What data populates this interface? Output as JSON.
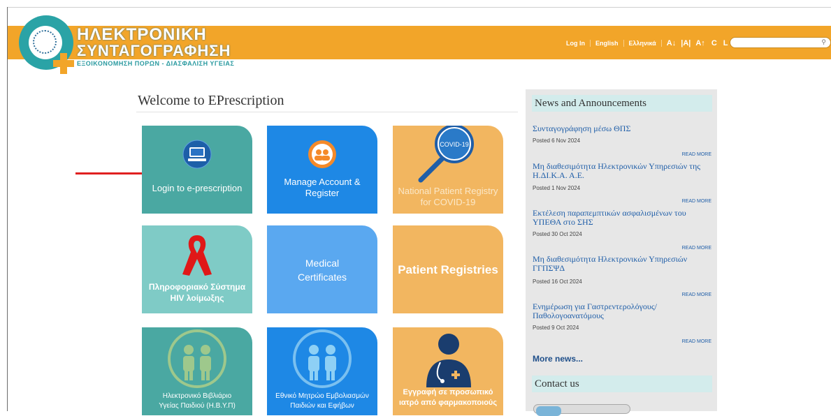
{
  "header": {
    "logo_line1": "ΗΛΕΚΤΡΟΝΙΚΗ",
    "logo_line2": "ΣΥΝΤΑΓΟΓΡΑΦΗΣΗ",
    "logo_tagline": "ΕΞΟΙΚΟΝΟΜΗΣΗ ΠΟΡΩΝ - ΔΙΑΣΦΑΛΙΣΗ ΥΓΕΙΑΣ",
    "nav": {
      "login": "Log In",
      "english": "English",
      "greek": "Ελληνικά",
      "font_decrease": "A↓",
      "font_reset": "|A|",
      "font_increase": "A↑",
      "contrast": "C",
      "layout": "L"
    },
    "search": {
      "placeholder": "",
      "icon": "search-icon"
    }
  },
  "main": {
    "title": "Welcome to EPrescription",
    "tiles": [
      {
        "label": "Login to e-prescription",
        "color": "#4aa8a2",
        "icon": "monitor-icon"
      },
      {
        "label": "Manage Account & Register",
        "color": "#1e88e5",
        "icon": "account-icon"
      },
      {
        "label": "National Patient Registry for COVID-19",
        "color": "#f2b660",
        "icon": "covid-magnifier-icon",
        "badge": "COVID-19"
      },
      {
        "label": "Πληροφοριακό Σύστημα HIV λοίμωξης",
        "color": "#7fcbc6",
        "icon": "red-ribbon-icon"
      },
      {
        "label": "Medical Certificates",
        "color": "#5aa8f0"
      },
      {
        "label": "Patient Registries",
        "color": "#f2b660"
      },
      {
        "label": "Ηλεκτρονικό Βιβλιάριο Υγείας Παιδιού (Η.Β.Υ.Π)",
        "color": "#4aa8a2",
        "icon": "children-icon"
      },
      {
        "label": "Εθνικό Μητρώο Εμβολιασμών Παιδιών και Εφήβων",
        "color": "#1e88e5",
        "icon": "children-icon"
      },
      {
        "label": "Εγγραφή σε προσωπικό ιατρό από φαρμακοποιούς",
        "color": "#f2b660",
        "icon": "doctor-icon"
      }
    ]
  },
  "sidebar": {
    "news_heading": "News and Announcements",
    "news": [
      {
        "title": "Συνταγογράφηση μέσω ΘΠΣ",
        "date": "Posted 6 Nov 2024",
        "more": "READ MORE"
      },
      {
        "title": "Μη διαθεσιμότητα Ηλεκτρονικών Υπηρεσιών της Η.ΔΙ.Κ.Α. Α.Ε.",
        "date": "Posted 1 Nov 2024",
        "more": "READ MORE"
      },
      {
        "title": "Εκτέλεση παραπεμπτικών ασφαλισμένων του ΥΠΕΘΑ στο ΣΗΣ",
        "date": "Posted 30 Oct 2024",
        "more": "READ MORE"
      },
      {
        "title": "Μη διαθεσιμότητα Ηλεκτρονικών Υπηρεσιών ΓΓΠΣΨΔ",
        "date": "Posted 16 Oct 2024",
        "more": "READ MORE"
      },
      {
        "title": "Ενημέρωση για Γαστρεντερολόγους/ Παθολογοανατόμους",
        "date": "Posted 9 Oct 2024",
        "more": "READ MORE"
      }
    ],
    "more_news": "More news...",
    "contact_heading": "Contact us"
  }
}
